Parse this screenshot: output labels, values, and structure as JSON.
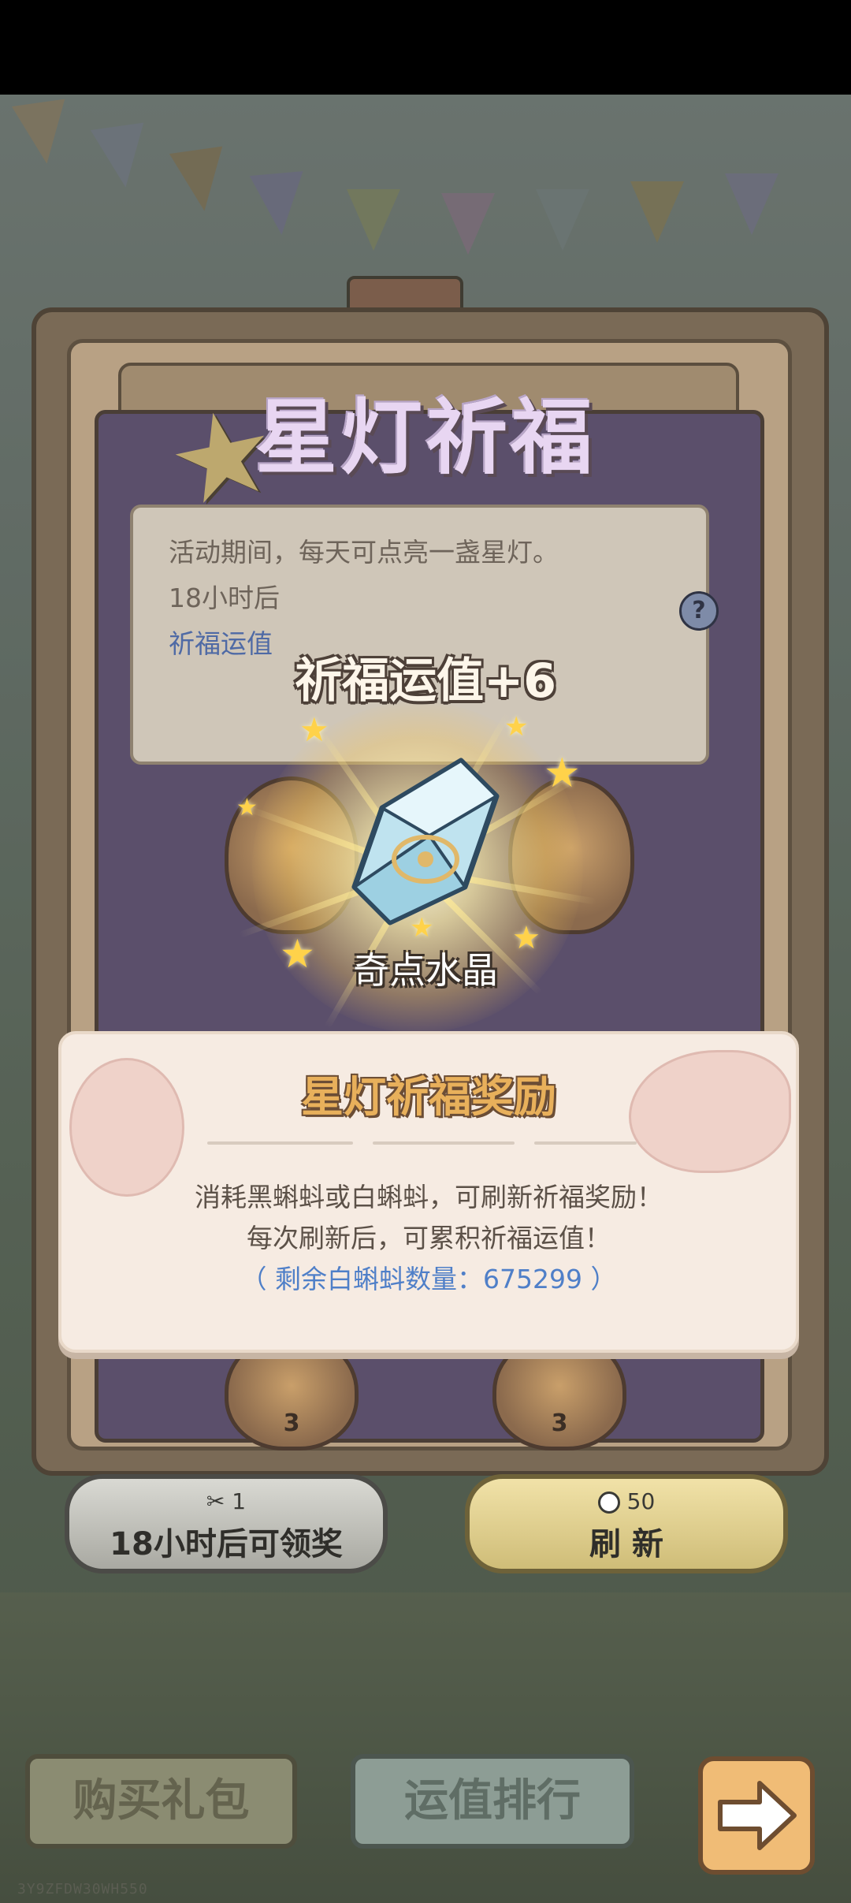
{
  "event": {
    "title": "星灯祈福",
    "info_lines": [
      "活动期间，每天可点亮一盏星灯。",
      "18小时后",
      "祈福运值"
    ]
  },
  "reward": {
    "fortune_text": "祈福运值+6",
    "item_name": "奇点水晶"
  },
  "dialog": {
    "title": "星灯祈福奖励",
    "line1": "消耗黑蝌蚪或白蝌蚪，可刷新祈福奖励！",
    "line2": "每次刷新后，可累积祈福运值！",
    "remaining": "（ 剩余白蝌蚪数量：675299 ）"
  },
  "lanterns": [
    {
      "num": "3"
    },
    {
      "num": "3"
    }
  ],
  "buttons": {
    "claim": {
      "cost": "1",
      "label": "18小时后可领奖",
      "icon": "scissors-icon"
    },
    "refresh": {
      "cost": "50",
      "label": "刷 新",
      "icon": "tadpole-icon"
    }
  },
  "bottom_nav": {
    "buy_pack": "购买礼包",
    "ranking": "运值排行",
    "next": "arrow-right-icon"
  },
  "watermark": "3Y9ZFDW30WH550",
  "colors": {
    "title": "#e8d6f2",
    "dialog_title": "#e8b05b",
    "remaining_text": "#4f7fc8",
    "refresh_button": "#f1e2a8",
    "claim_button": "#d9d9d3"
  }
}
